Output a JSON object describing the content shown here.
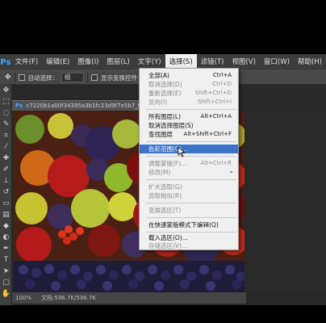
{
  "menubar": {
    "logo": "Ps",
    "items": [
      {
        "label": "文件(F)"
      },
      {
        "label": "编辑(E)"
      },
      {
        "label": "图像(I)"
      },
      {
        "label": "图层(L)"
      },
      {
        "label": "文字(Y)"
      },
      {
        "label": "选择(S)",
        "active": true
      },
      {
        "label": "滤镜(T)"
      },
      {
        "label": "视图(V)"
      },
      {
        "label": "窗口(W)"
      },
      {
        "label": "帮助(H)"
      }
    ]
  },
  "options": {
    "auto_select_label": "自动选择：",
    "auto_select_value": "组",
    "show_transform_label": "显示变换控件"
  },
  "document": {
    "tab_logo": "Ps",
    "tab_title": "c7220b1a00f34395a3b1fc23d9f7e5b7_th[0].jpg",
    "zoom": "100%",
    "doc_info": "文档:596.7K/596.7K"
  },
  "select_menu": {
    "items": [
      {
        "label": "全部(A)",
        "shortcut": "Ctrl+A",
        "disabled": false
      },
      {
        "label": "取消选择(D)",
        "shortcut": "Ctrl+D",
        "disabled": true
      },
      {
        "label": "重新选择(E)",
        "shortcut": "Shift+Ctrl+D",
        "disabled": true
      },
      {
        "label": "反向(I)",
        "shortcut": "Shift+Ctrl+I",
        "disabled": true
      },
      {
        "label": "所有图层(L)",
        "shortcut": "Alt+Ctrl+A",
        "disabled": false
      },
      {
        "label": "取消选择图层(S)",
        "shortcut": "",
        "disabled": false
      },
      {
        "label": "查找图层",
        "shortcut": "Alt+Shift+Ctrl+F",
        "disabled": false
      },
      {
        "label": "色彩范围(C)...",
        "shortcut": "",
        "disabled": false,
        "highlighted": true
      },
      {
        "label": "调整蒙版(F)...",
        "shortcut": "Alt+Ctrl+R",
        "disabled": true
      },
      {
        "label": "修改(M)",
        "shortcut": "",
        "disabled": true,
        "submenu": true
      },
      {
        "label": "扩大选取(G)",
        "shortcut": "",
        "disabled": true
      },
      {
        "label": "选取相似(R)",
        "shortcut": "",
        "disabled": true
      },
      {
        "label": "变换选区(T)",
        "shortcut": "",
        "disabled": true
      },
      {
        "label": "在快速蒙版模式下编辑(Q)",
        "shortcut": "",
        "disabled": false
      },
      {
        "label": "载入选区(O)...",
        "shortcut": "",
        "disabled": false
      },
      {
        "label": "存储选区(V)...",
        "shortcut": "",
        "disabled": true
      }
    ]
  },
  "colors": {
    "menu_highlight": "#3c73c7",
    "ps_blue": "#47a6ff"
  }
}
